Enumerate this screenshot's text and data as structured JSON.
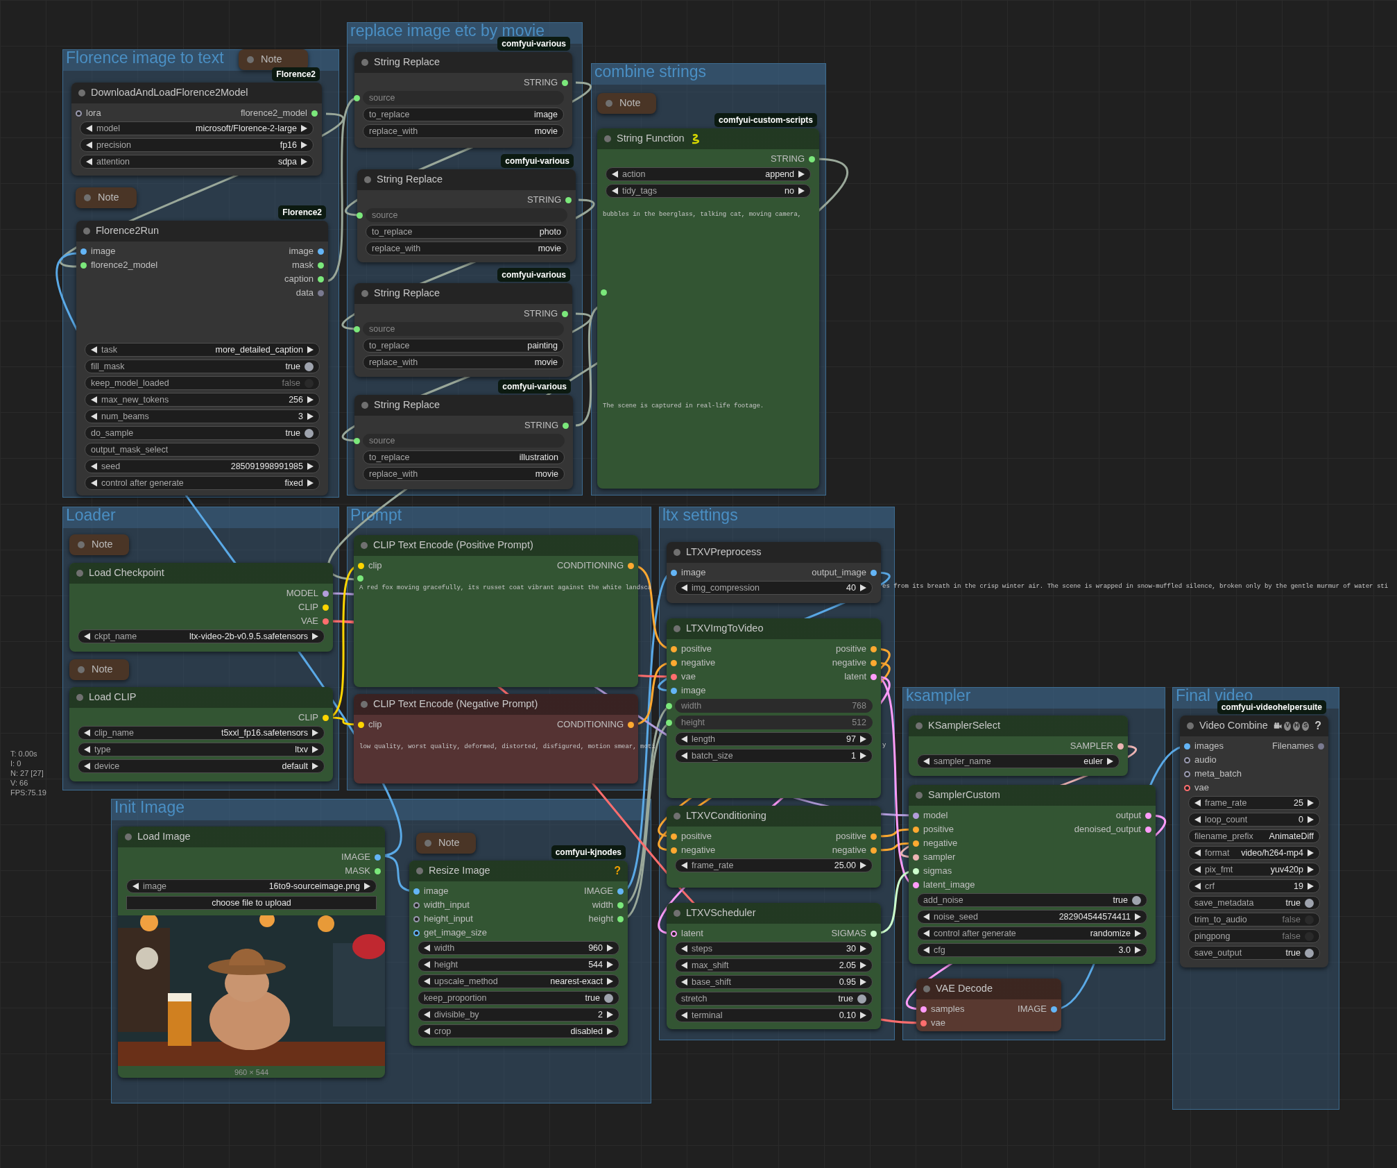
{
  "stats": [
    "T: 0.00s",
    "I: 0",
    "N: 27 [27]",
    "V: 66",
    "FPS:75.19"
  ],
  "groups": [
    {
      "title": "Florence image to text",
      "nodes": [
        {
          "kind": "note",
          "title": "Note"
        },
        {
          "kind": "node",
          "color": "#353535",
          "title": "DownloadAndLoadFlorence2Model",
          "badge": "Florence2",
          "inputs": [
            {
              "name": "lora",
              "color": "#9a9ab0",
              "optional": true
            }
          ],
          "outputs": [
            {
              "name": "florence2_model",
              "color": "#7be87b",
              "optional": false
            }
          ],
          "widgets": [
            {
              "kind": "combo",
              "label": "model",
              "value": "microsoft/Florence-2-large"
            },
            {
              "kind": "combo",
              "label": "precision",
              "value": "fp16"
            },
            {
              "kind": "combo",
              "label": "attention",
              "value": "sdpa"
            }
          ]
        },
        {
          "kind": "note",
          "title": "Note"
        },
        {
          "kind": "node",
          "color": "#353535",
          "title": "Florence2Run",
          "badge": "Florence2",
          "inputs": [
            {
              "name": "image",
              "color": "#64b5f6",
              "optional": false
            },
            {
              "name": "florence2_model",
              "color": "#7be87b",
              "optional": false
            }
          ],
          "outputs": [
            {
              "name": "image",
              "color": "#64b5f6",
              "optional": false
            },
            {
              "name": "mask",
              "color": "#7be87b",
              "optional": false
            },
            {
              "name": "caption",
              "color": "#7be87b",
              "optional": false
            },
            {
              "name": "data",
              "color": "#7a7a90",
              "optional": false
            }
          ],
          "widgets": [
            {
              "kind": "combo",
              "label": "task",
              "value": "more_detailed_caption"
            },
            {
              "kind": "toggle",
              "label": "fill_mask",
              "value": "true",
              "on": true
            },
            {
              "kind": "toggle",
              "label": "keep_model_loaded",
              "value": "false",
              "on": false
            },
            {
              "kind": "number",
              "label": "max_new_tokens",
              "value": "256"
            },
            {
              "kind": "number",
              "label": "num_beams",
              "value": "3"
            },
            {
              "kind": "toggle",
              "label": "do_sample",
              "value": "true",
              "on": true
            },
            {
              "kind": "text",
              "label": "output_mask_select"
            },
            {
              "kind": "number",
              "label": "seed",
              "value": "285091998991985"
            },
            {
              "kind": "combo",
              "label": "control after generate",
              "value": "fixed"
            }
          ]
        }
      ]
    },
    {
      "title": "replace image etc by movie",
      "nodes": [
        {
          "kind": "node",
          "color": "#353535",
          "title": "String Replace",
          "badge": "comfyui-various",
          "outputs": [
            {
              "name": "STRING",
              "color": "#7be87b",
              "optional": false
            }
          ],
          "widgets": [
            {
              "kind": "converted",
              "label": "source",
              "color": "#7be87b"
            },
            {
              "kind": "text",
              "label": "to_replace",
              "value": "image"
            },
            {
              "kind": "text",
              "label": "replace_with",
              "value": "movie"
            }
          ]
        },
        {
          "kind": "node",
          "color": "#353535",
          "title": "String Replace",
          "badge": "comfyui-various",
          "outputs": [
            {
              "name": "STRING",
              "color": "#7be87b",
              "optional": false
            }
          ],
          "widgets": [
            {
              "kind": "converted",
              "label": "source",
              "color": "#7be87b"
            },
            {
              "kind": "text",
              "label": "to_replace",
              "value": "photo"
            },
            {
              "kind": "text",
              "label": "replace_with",
              "value": "movie"
            }
          ]
        },
        {
          "kind": "node",
          "color": "#353535",
          "title": "String Replace",
          "badge": "comfyui-various",
          "outputs": [
            {
              "name": "STRING",
              "color": "#7be87b",
              "optional": false
            }
          ],
          "widgets": [
            {
              "kind": "converted",
              "label": "source",
              "color": "#7be87b"
            },
            {
              "kind": "text",
              "label": "to_replace",
              "value": "painting"
            },
            {
              "kind": "text",
              "label": "replace_with",
              "value": "movie"
            }
          ]
        },
        {
          "kind": "node",
          "color": "#353535",
          "title": "String Replace",
          "badge": "comfyui-various",
          "outputs": [
            {
              "name": "STRING",
              "color": "#7be87b",
              "optional": false
            }
          ],
          "widgets": [
            {
              "kind": "converted",
              "label": "source",
              "color": "#7be87b"
            },
            {
              "kind": "text",
              "label": "to_replace",
              "value": "illustration"
            },
            {
              "kind": "text",
              "label": "replace_with",
              "value": "movie"
            }
          ]
        }
      ]
    },
    {
      "title": "combine strings",
      "nodes": [
        {
          "kind": "note",
          "title": "Note"
        },
        {
          "kind": "node",
          "color": "#335533",
          "title": "String Function",
          "title_icon": {
            "kind": "snake"
          },
          "badge": "comfyui-custom-scripts",
          "outputs": [
            {
              "name": "STRING",
              "color": "#7be87b",
              "optional": false
            }
          ],
          "widgets": [
            {
              "kind": "combo",
              "label": "action",
              "value": "append"
            },
            {
              "kind": "combo",
              "label": "tidy_tags",
              "value": "no"
            },
            {
              "kind": "textarea",
              "lines": [
                "bubbles in the beerglass, talking cat, moving camera,",
                "The scene is captured in real-life footage."
              ],
              "color": "#7be87b"
            }
          ]
        }
      ]
    },
    {
      "title": "Loader",
      "nodes": [
        {
          "kind": "note",
          "title": "Note"
        },
        {
          "kind": "node",
          "color": "#335533",
          "title": "Load Checkpoint",
          "outputs": [
            {
              "name": "MODEL",
              "color": "#b39ddb",
              "optional": false
            },
            {
              "name": "CLIP",
              "color": "#ffd500",
              "optional": false
            },
            {
              "name": "VAE",
              "color": "#ff6e6e",
              "optional": false
            }
          ],
          "widgets": [
            {
              "kind": "combo",
              "label": "ckpt_name",
              "value": "ltx-video-2b-v0.9.5.safetensors"
            }
          ]
        },
        {
          "kind": "note",
          "title": "Note"
        },
        {
          "kind": "node",
          "color": "#335533",
          "title": "Load CLIP",
          "outputs": [
            {
              "name": "CLIP",
              "color": "#ffd500",
              "optional": false
            }
          ],
          "widgets": [
            {
              "kind": "combo",
              "label": "clip_name",
              "value": "t5xxl_fp16.safetensors"
            },
            {
              "kind": "combo",
              "label": "type",
              "value": "ltxv"
            },
            {
              "kind": "combo",
              "label": "device",
              "value": "default"
            }
          ]
        }
      ]
    },
    {
      "title": "Prompt",
      "nodes": [
        {
          "kind": "node",
          "color": "#335533",
          "title": "CLIP Text Encode (Positive Prompt)",
          "inputs": [
            {
              "name": "clip",
              "color": "#ffd500",
              "optional": false
            }
          ],
          "outputs": [
            {
              "name": "CONDITIONING",
              "color": "#ffa931",
              "optional": false
            }
          ],
          "widgets": [
            {
              "kind": "textarea",
              "lines": [
                "A red fox moving gracefully, its russet coat vibrant against the white landsca"
              ],
              "overflow": "es from its breath in the crisp winter air. The scene is wrapped in snow-muffled silence, broken only by the gentle murmur of water sti",
              "color": "#7be87b"
            }
          ]
        },
        {
          "kind": "node",
          "color": "#553333",
          "title": "CLIP Text Encode (Negative Prompt)",
          "inputs": [
            {
              "name": "clip",
              "color": "#ffd500",
              "optional": false
            }
          ],
          "outputs": [
            {
              "name": "CONDITIONING",
              "color": "#ffa931",
              "optional": false
            }
          ],
          "widgets": [
            {
              "kind": "textarea",
              "lines": [
                "low quality, worst quality, deformed, distorted, disfigured, motion smear, moti"
              ],
              "overflow": "y"
            }
          ]
        }
      ]
    },
    {
      "title": "ltx settings",
      "nodes": [
        {
          "kind": "node",
          "color": "#353535",
          "title": "LTXVPreprocess",
          "inputs": [
            {
              "name": "image",
              "color": "#64b5f6",
              "optional": false
            }
          ],
          "outputs": [
            {
              "name": "output_image",
              "color": "#64b5f6",
              "optional": false
            }
          ],
          "widgets": [
            {
              "kind": "number",
              "label": "img_compression",
              "value": "40"
            }
          ]
        },
        {
          "kind": "node",
          "color": "#335533",
          "title": "LTXVImgToVideo",
          "inputs": [
            {
              "name": "positive",
              "color": "#ffa931",
              "optional": false
            },
            {
              "name": "negative",
              "color": "#ffa931",
              "optional": false
            },
            {
              "name": "vae",
              "color": "#ff6e6e",
              "optional": false
            },
            {
              "name": "image",
              "color": "#64b5f6",
              "optional": false
            }
          ],
          "outputs": [
            {
              "name": "positive",
              "color": "#ffa931",
              "optional": false
            },
            {
              "name": "negative",
              "color": "#ffa931",
              "optional": false
            },
            {
              "name": "latent",
              "color": "#ff9cf9",
              "optional": false
            }
          ],
          "widgets": [
            {
              "kind": "converted",
              "label": "width",
              "value": "768",
              "color": "#7be87b"
            },
            {
              "kind": "converted",
              "label": "height",
              "value": "512",
              "color": "#7be87b"
            },
            {
              "kind": "number",
              "label": "length",
              "value": "97"
            },
            {
              "kind": "number",
              "label": "batch_size",
              "value": "1"
            }
          ]
        },
        {
          "kind": "node",
          "color": "#335533",
          "title": "LTXVConditioning",
          "inputs": [
            {
              "name": "positive",
              "color": "#ffa931",
              "optional": false
            },
            {
              "name": "negative",
              "color": "#ffa931",
              "optional": false
            }
          ],
          "outputs": [
            {
              "name": "positive",
              "color": "#ffa931",
              "optional": false
            },
            {
              "name": "negative",
              "color": "#ffa931",
              "optional": false
            }
          ],
          "widgets": [
            {
              "kind": "number",
              "label": "frame_rate",
              "value": "25.00"
            }
          ]
        },
        {
          "kind": "node",
          "color": "#335533",
          "title": "LTXVScheduler",
          "inputs": [
            {
              "name": "latent",
              "color": "#ff9cf9",
              "optional": true
            }
          ],
          "outputs": [
            {
              "name": "SIGMAS",
              "color": "#cdffcd",
              "optional": false
            }
          ],
          "widgets": [
            {
              "kind": "number",
              "label": "steps",
              "value": "30"
            },
            {
              "kind": "number",
              "label": "max_shift",
              "value": "2.05"
            },
            {
              "kind": "number",
              "label": "base_shift",
              "value": "0.95"
            },
            {
              "kind": "toggle",
              "label": "stretch",
              "value": "true",
              "on": true
            },
            {
              "kind": "number",
              "label": "terminal",
              "value": "0.10"
            }
          ]
        }
      ]
    },
    {
      "title": "Init Image",
      "nodes": [
        {
          "kind": "node",
          "color": "#335533",
          "title": "Load Image",
          "outputs": [
            {
              "name": "IMAGE",
              "color": "#64b5f6",
              "optional": false
            },
            {
              "name": "MASK",
              "color": "#7be87b",
              "optional": false
            }
          ],
          "widgets": [
            {
              "kind": "combo",
              "label": "image",
              "value": "16to9-sourceimage.png"
            },
            {
              "kind": "button",
              "label": "choose file to upload"
            }
          ],
          "preview": {
            "kind": "picture",
            "caption": "960 × 544"
          }
        },
        {
          "kind": "note",
          "title": "Note"
        },
        {
          "kind": "node",
          "color": "#335533",
          "title": "Resize Image",
          "help": {
            "text": "?",
            "color": "#f0a000"
          },
          "badge": "comfyui-kjnodes",
          "inputs": [
            {
              "name": "image",
              "color": "#64b5f6",
              "optional": false
            },
            {
              "name": "width_input",
              "color": "#9a9ab0",
              "optional": true
            },
            {
              "name": "height_input",
              "color": "#9a9ab0",
              "optional": true
            },
            {
              "name": "get_image_size",
              "color": "#64b5f6",
              "optional": true
            }
          ],
          "outputs": [
            {
              "name": "IMAGE",
              "color": "#64b5f6",
              "optional": false
            },
            {
              "name": "width",
              "color": "#7be87b",
              "optional": false
            },
            {
              "name": "height",
              "color": "#7be87b",
              "optional": false
            }
          ],
          "widgets": [
            {
              "kind": "number",
              "label": "width",
              "value": "960"
            },
            {
              "kind": "number",
              "label": "height",
              "value": "544"
            },
            {
              "kind": "combo",
              "label": "upscale_method",
              "value": "nearest-exact"
            },
            {
              "kind": "toggle",
              "label": "keep_proportion",
              "value": "true",
              "on": true
            },
            {
              "kind": "number",
              "label": "divisible_by",
              "value": "2"
            },
            {
              "kind": "combo",
              "label": "crop",
              "value": "disabled"
            }
          ]
        }
      ]
    },
    {
      "title": "ksampler",
      "nodes": [
        {
          "kind": "node",
          "color": "#335533",
          "title": "KSamplerSelect",
          "outputs": [
            {
              "name": "SAMPLER",
              "color": "#ecb4b4",
              "optional": false
            }
          ],
          "widgets": [
            {
              "kind": "combo",
              "label": "sampler_name",
              "value": "euler"
            }
          ]
        },
        {
          "kind": "node",
          "color": "#335533",
          "title": "SamplerCustom",
          "inputs": [
            {
              "name": "model",
              "color": "#b39ddb",
              "optional": false
            },
            {
              "name": "positive",
              "color": "#ffa931",
              "optional": false
            },
            {
              "name": "negative",
              "color": "#ffa931",
              "optional": false
            },
            {
              "name": "sampler",
              "color": "#ecb4b4",
              "optional": false
            },
            {
              "name": "sigmas",
              "color": "#cdffcd",
              "optional": false
            },
            {
              "name": "latent_image",
              "color": "#ff9cf9",
              "optional": false
            }
          ],
          "outputs": [
            {
              "name": "output",
              "color": "#ff9cf9",
              "optional": false
            },
            {
              "name": "denoised_output",
              "color": "#ff9cf9",
              "optional": false
            }
          ],
          "widgets": [
            {
              "kind": "toggle",
              "label": "add_noise",
              "value": "true",
              "on": true
            },
            {
              "kind": "number",
              "label": "noise_seed",
              "value": "282904544574411"
            },
            {
              "kind": "combo",
              "label": "control after generate",
              "value": "randomize"
            },
            {
              "kind": "number",
              "label": "cfg",
              "value": "3.0"
            }
          ]
        },
        {
          "kind": "node",
          "color": "#593930",
          "title": "VAE Decode",
          "inputs": [
            {
              "name": "samples",
              "color": "#ff9cf9",
              "optional": false
            },
            {
              "name": "vae",
              "color": "#ff6e6e",
              "optional": false
            }
          ],
          "outputs": [
            {
              "name": "IMAGE",
              "color": "#64b5f6",
              "optional": false
            }
          ]
        }
      ]
    },
    {
      "title": "Final video",
      "nodes": [
        {
          "kind": "node",
          "color": "#353535",
          "title": "Video Combine",
          "title_icon": {
            "kind": "camera"
          },
          "title_marks": [
            "V",
            "H",
            "S"
          ],
          "help": {
            "text": "?",
            "color": "#cccccc"
          },
          "badge": "comfyui-videohelpersuite",
          "inputs": [
            {
              "name": "images",
              "color": "#64b5f6",
              "optional": false
            },
            {
              "name": "audio",
              "color": "#9a9ab0",
              "optional": true
            },
            {
              "name": "meta_batch",
              "color": "#9a9ab0",
              "optional": true
            },
            {
              "name": "vae",
              "color": "#ff6e6e",
              "optional": true
            }
          ],
          "outputs": [
            {
              "name": "Filenames",
              "color": "#7a7a90",
              "optional": false
            }
          ],
          "widgets": [
            {
              "kind": "number",
              "label": "frame_rate",
              "value": "25"
            },
            {
              "kind": "number",
              "label": "loop_count",
              "value": "0"
            },
            {
              "kind": "text",
              "label": "filename_prefix",
              "value": "AnimateDiff"
            },
            {
              "kind": "combo",
              "label": "format",
              "value": "video/h264-mp4"
            },
            {
              "kind": "combo",
              "label": "pix_fmt",
              "value": "yuv420p"
            },
            {
              "kind": "number",
              "label": "crf",
              "value": "19"
            },
            {
              "kind": "toggle",
              "label": "save_metadata",
              "value": "true",
              "on": true
            },
            {
              "kind": "toggle",
              "label": "trim_to_audio",
              "value": "false",
              "on": false
            },
            {
              "kind": "toggle",
              "label": "pingpong",
              "value": "false",
              "on": false
            },
            {
              "kind": "toggle",
              "label": "save_output",
              "value": "true",
              "on": true
            }
          ]
        }
      ]
    }
  ]
}
